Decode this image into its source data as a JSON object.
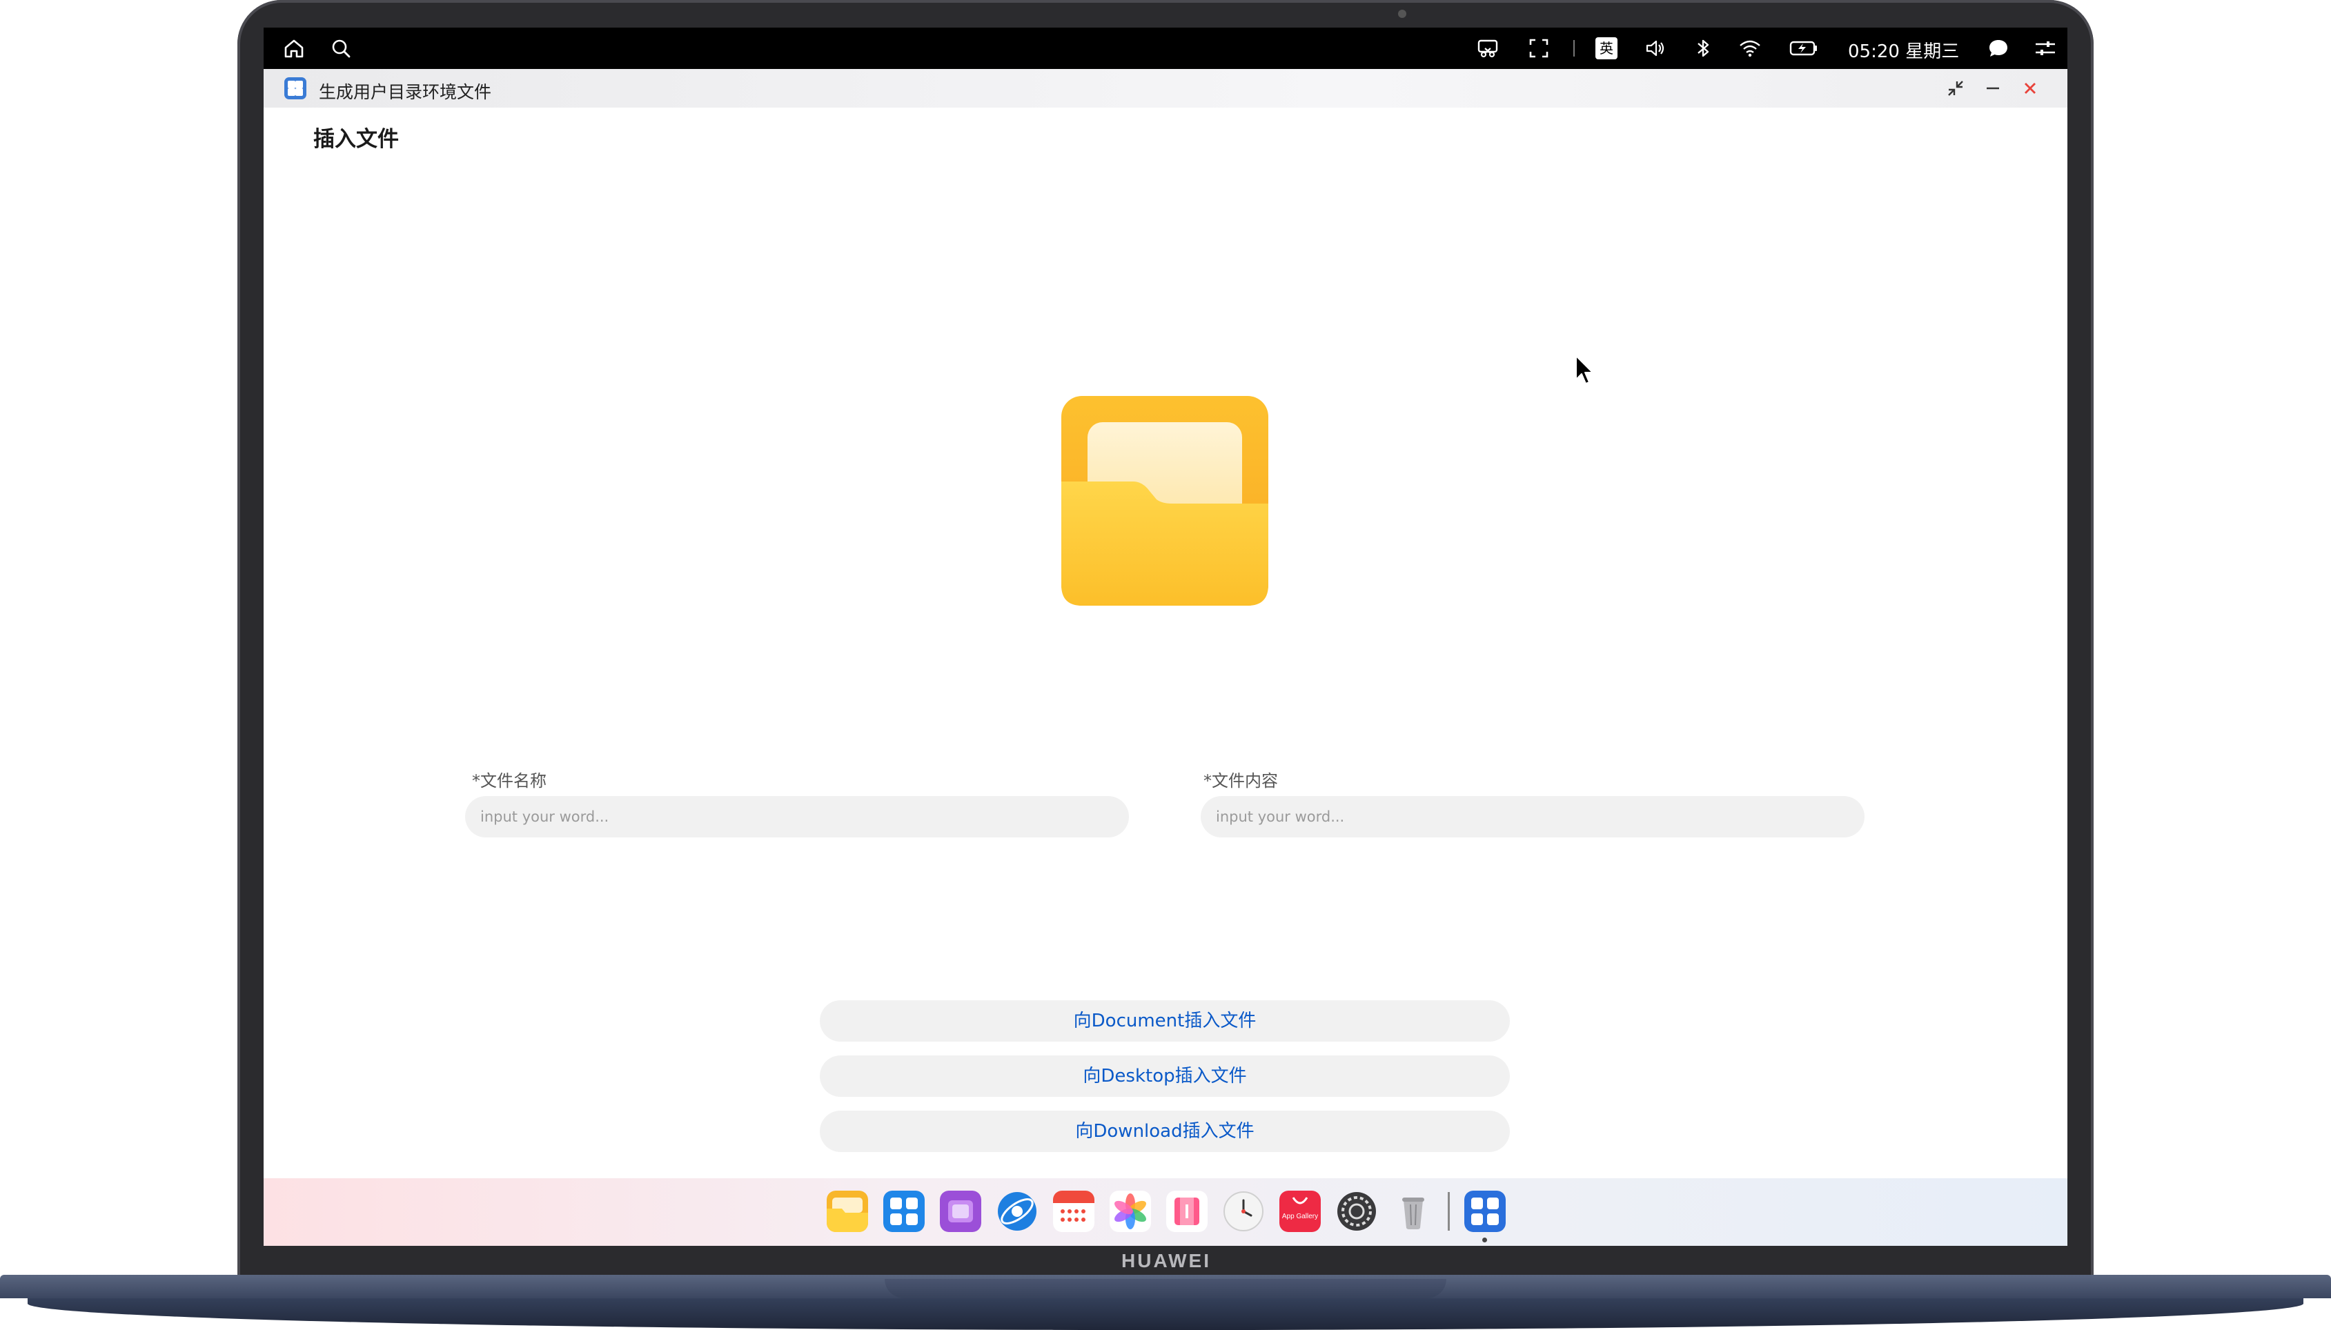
{
  "status_bar": {
    "time": "05:20 星期三",
    "input_language": "英",
    "icons": [
      "home-icon",
      "search-icon",
      "screenshot-icon",
      "screen-fullscreen-icon",
      "volume-icon",
      "bluetooth-icon",
      "wifi-icon",
      "battery-charging-icon",
      "notification-icon",
      "control-center-icon"
    ]
  },
  "window": {
    "title": "生成用户目录环境文件",
    "buttons": [
      "restore",
      "minimize",
      "close"
    ],
    "close_color": "#e8423a"
  },
  "page": {
    "title": "插入文件",
    "folder_icon": "folder-icon",
    "file_name": {
      "label": "*文件名称",
      "placeholder": "input your word...",
      "value": ""
    },
    "file_content": {
      "label": "*文件内容",
      "placeholder": "input your word...",
      "value": ""
    },
    "buttons": {
      "document": "向Document插入文件",
      "desktop": "向Desktop插入文件",
      "download": "向Download插入文件"
    },
    "accent_color": "#0a59c8"
  },
  "dock": {
    "apps": [
      "files",
      "app-center",
      "multi-window",
      "browser",
      "calendar",
      "photos",
      "notes",
      "clock",
      "app-gallery",
      "settings",
      "trash"
    ],
    "app_gallery_label": "App Gallery",
    "running_app": "user-dir-file-generator"
  },
  "device": {
    "brand": "HUAWEI"
  }
}
